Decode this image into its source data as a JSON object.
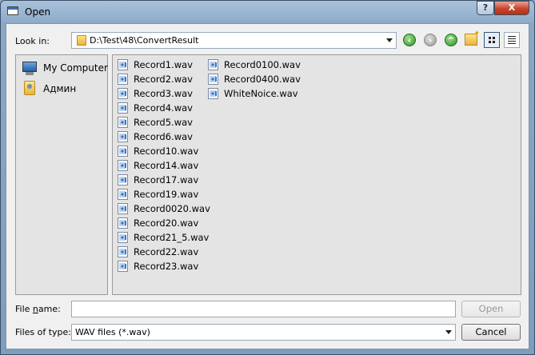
{
  "window": {
    "title": "Open",
    "help_label": "?",
    "close_label": "X"
  },
  "lookin": {
    "label": "Look in:",
    "path": "D:\\Test\\48\\ConvertResult"
  },
  "toolbar": {
    "back_icon": "back-arrow-icon",
    "forward_icon": "forward-arrow-icon",
    "up_icon": "up-arrow-icon",
    "new_folder_icon": "new-folder-icon",
    "detail_view_icon": "detail-view-icon",
    "list_view_icon": "list-view-icon"
  },
  "sidebar": {
    "items": [
      {
        "label": "My Computer",
        "icon": "computer-icon"
      },
      {
        "label": "Админ",
        "icon": "user-folder-icon"
      }
    ]
  },
  "files": {
    "column1": [
      "Record1.wav",
      "Record2.wav",
      "Record3.wav",
      "Record4.wav",
      "Record5.wav",
      "Record6.wav",
      "Record10.wav",
      "Record14.wav",
      "Record17.wav",
      "Record19.wav",
      "Record0020.wav",
      "Record20.wav",
      "Record21_5.wav",
      "Record22.wav",
      "Record23.wav"
    ],
    "column2": [
      "Record0100.wav",
      "Record0400.wav",
      "WhiteNoice.wav"
    ]
  },
  "filename": {
    "label_pre": "File ",
    "label_u": "n",
    "label_post": "ame:",
    "value": ""
  },
  "filetype": {
    "label": "Files of type:",
    "value": "WAV files (*.wav)"
  },
  "buttons": {
    "open": "Open",
    "cancel": "Cancel"
  }
}
